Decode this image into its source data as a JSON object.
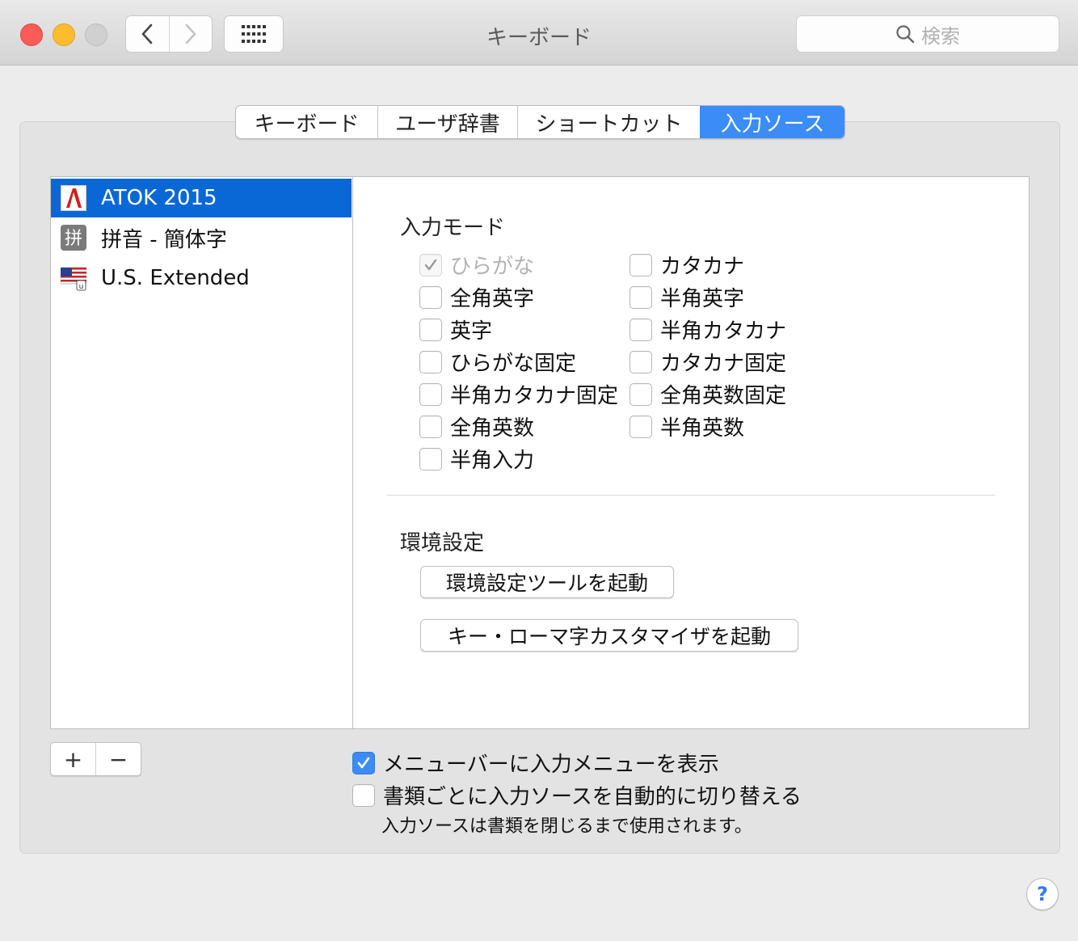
{
  "window": {
    "title": "キーボード"
  },
  "toolbar": {
    "search_placeholder": "検索"
  },
  "tabs": [
    {
      "label": "キーボード"
    },
    {
      "label": "ユーザ辞書"
    },
    {
      "label": "ショートカット"
    },
    {
      "label": "入力ソース",
      "active": true
    }
  ],
  "sources": [
    {
      "label": "ATOK 2015",
      "icon": "atok-icon",
      "selected": true
    },
    {
      "label": "拼音 - 簡体字",
      "icon": "pinyin-icon",
      "selected": false
    },
    {
      "label": "U.S. Extended",
      "icon": "us-flag-icon",
      "selected": false
    }
  ],
  "input_mode": {
    "title": "入力モード",
    "left": [
      {
        "label": "ひらがな",
        "checked": true,
        "disabled": true
      },
      {
        "label": "全角英字",
        "checked": false
      },
      {
        "label": "英字",
        "checked": false
      },
      {
        "label": "ひらがな固定",
        "checked": false
      },
      {
        "label": "半角カタカナ固定",
        "checked": false
      },
      {
        "label": "全角英数",
        "checked": false
      },
      {
        "label": "半角入力",
        "checked": false
      }
    ],
    "right": [
      {
        "label": "カタカナ",
        "checked": false
      },
      {
        "label": "半角英字",
        "checked": false
      },
      {
        "label": "半角カタカナ",
        "checked": false
      },
      {
        "label": "カタカナ固定",
        "checked": false
      },
      {
        "label": "全角英数固定",
        "checked": false
      },
      {
        "label": "半角英数",
        "checked": false
      }
    ]
  },
  "prefs": {
    "title": "環境設定",
    "launch_tool": "環境設定ツールを起動",
    "launch_customizer": "キー・ローマ字カスタマイザを起動"
  },
  "list_controls": {
    "add": "+",
    "remove": "−"
  },
  "options": {
    "show_menu": {
      "label": "メニューバーに入力メニューを表示",
      "checked": true
    },
    "auto_switch": {
      "label": "書類ごとに入力ソースを自動的に切り替える",
      "checked": false
    },
    "note": "入力ソースは書類を閉じるまで使用されます。"
  },
  "help": {
    "label": "?"
  },
  "colors": {
    "accent": "#3b8cf6",
    "selection": "#0a68d6"
  }
}
